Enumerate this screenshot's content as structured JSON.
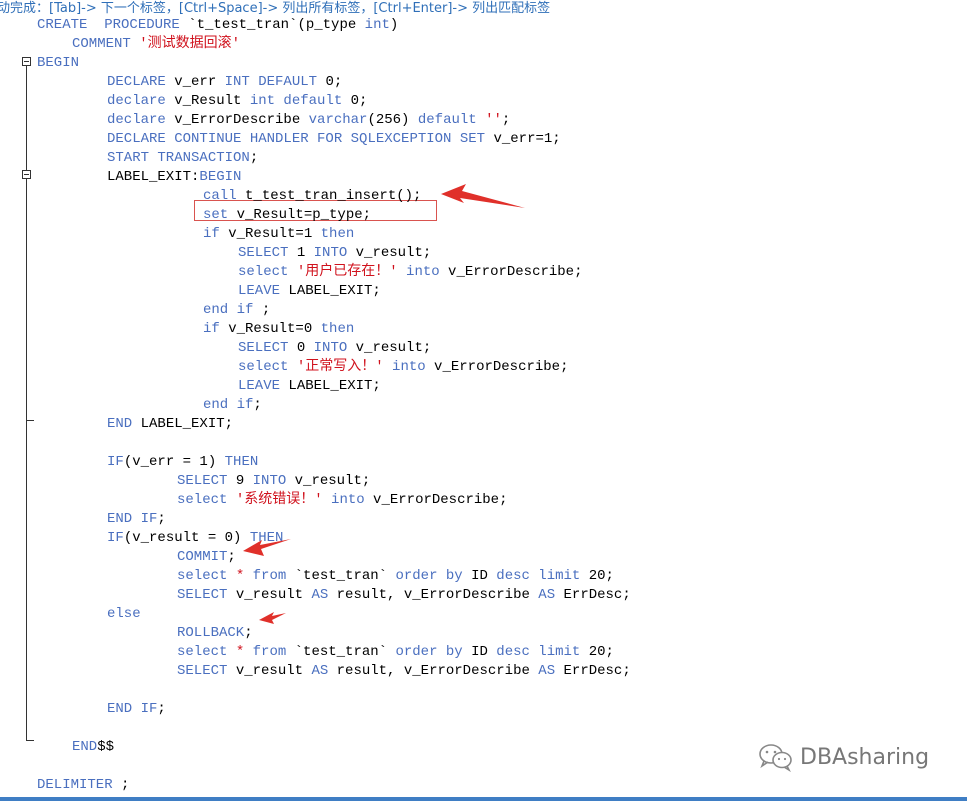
{
  "hint_bar": {
    "text": "动完成：[Tab]-> 下一个标签，[Ctrl+Space]-> 列出所有标签，[Ctrl+Enter]-> 列出匹配标签"
  },
  "code": {
    "l1_kw": "CREATE  PROCEDURE",
    "l1_rest": " `t_test_tran`(p_type ",
    "l1_type": "int",
    "l1_end": ")",
    "l2_kw": "COMMENT",
    "l2_str": " '测试数据回滚'",
    "l3_kw": "BEGIN",
    "l4_kw1": "DECLARE",
    "l4_id": " v_err ",
    "l4_kw2": "INT DEFAULT",
    "l4_end": " 0;",
    "l5_kw1": "declare",
    "l5_id": " v_Result ",
    "l5_kw2": "int default",
    "l5_end": " 0;",
    "l6_kw1": "declare",
    "l6_id": " v_ErrorDescribe ",
    "l6_kw2": "varchar",
    "l6_mid": "(256) ",
    "l6_kw3": "default",
    "l6_str": " ''",
    "l6_end": ";",
    "l7_kw": "DECLARE CONTINUE HANDLER FOR SQLEXCEPTION SET",
    "l7_end": " v_err=1;",
    "l8_kw": "START TRANSACTION",
    "l8_end": ";",
    "l9_label": "LABEL_EXIT:",
    "l9_kw": "BEGIN",
    "l10_kw": "call",
    "l10_rest": " t_test_tran_insert();",
    "l11_kw": "set",
    "l11_rest": " v_Result=p_type;",
    "l12_kw1": "if",
    "l12_rest": " v_Result=1 ",
    "l12_kw2": "then",
    "l13_kw1": "SELECT",
    "l13_mid": " 1 ",
    "l13_kw2": "INTO",
    "l13_end": " v_result;",
    "l14_kw1": "select",
    "l14_str": " '用户已存在！'",
    "l14_kw2": " into",
    "l14_end": " v_ErrorDescribe;",
    "l15_kw": "LEAVE",
    "l15_end": " LABEL_EXIT;",
    "l16_kw": "end if",
    "l16_end": " ;",
    "l17_kw1": "if",
    "l17_rest": " v_Result=0 ",
    "l17_kw2": "then",
    "l18_kw1": "SELECT",
    "l18_mid": " 0 ",
    "l18_kw2": "INTO",
    "l18_end": " v_result;",
    "l19_kw1": "select",
    "l19_str": " '正常写入！'",
    "l19_kw2": " into",
    "l19_end": " v_ErrorDescribe;",
    "l20_kw": "LEAVE",
    "l20_end": " LABEL_EXIT;",
    "l21_kw": "end if",
    "l21_end": ";",
    "l22_kw": "END",
    "l22_end": " LABEL_EXIT;",
    "l23_kw1": "IF",
    "l23_rest": "(v_err = 1) ",
    "l23_kw2": "THEN",
    "l24_kw1": "SELECT",
    "l24_mid": " 9 ",
    "l24_kw2": "INTO",
    "l24_end": " v_result;",
    "l25_kw1": "select",
    "l25_str": " '系统错误！'",
    "l25_kw2": " into",
    "l25_end": " v_ErrorDescribe;",
    "l26_kw": "END IF",
    "l26_end": ";",
    "l27_kw1": "IF",
    "l27_rest": "(v_result = 0) ",
    "l27_kw2": "THEN",
    "l28_kw": "COMMIT",
    "l28_end": ";",
    "l29_kw1": "select",
    "l29_star": " * ",
    "l29_kw2": "from",
    "l29_rest": " `test_tran` ",
    "l29_kw3": "order by",
    "l29_id": " ID ",
    "l29_kw4": "desc limit",
    "l29_end": " 20;",
    "l30_kw1": "SELECT",
    "l30_rest": " v_result ",
    "l30_kw2": "AS",
    "l30_mid": " result, v_ErrorDescribe ",
    "l30_kw3": "AS",
    "l30_end": " ErrDesc;",
    "l31_kw": "else",
    "l32_kw": "ROLLBACK",
    "l32_end": ";",
    "l33_kw1": "select",
    "l33_star": " * ",
    "l33_kw2": "from",
    "l33_rest": " `test_tran` ",
    "l33_kw3": "order by",
    "l33_id": " ID ",
    "l33_kw4": "desc limit",
    "l33_end": " 20;",
    "l34_kw1": "SELECT",
    "l34_rest": " v_result ",
    "l34_kw2": "AS",
    "l34_mid": " result, v_ErrorDescribe ",
    "l34_kw3": "AS",
    "l34_end": " ErrDesc;",
    "l35_kw": "END IF",
    "l35_end": ";",
    "l36_kw": "END",
    "l36_end": "$$",
    "l37_kw": "DELIMITER",
    "l37_end": " ;"
  },
  "watermark": {
    "text": "DBAsharing",
    "icon": "wechat-icon"
  },
  "colors": {
    "keyword": "#4a6fbf",
    "string": "#d0121d",
    "annotation": "#e0302a",
    "hint": "#2f6fb8"
  }
}
